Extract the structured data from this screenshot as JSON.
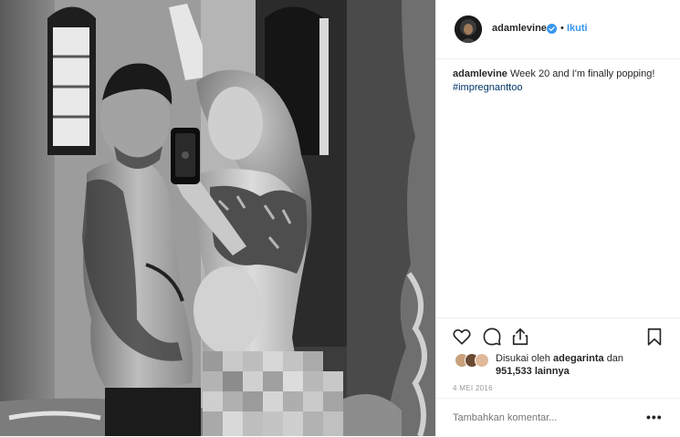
{
  "post": {
    "username": "adamlevine",
    "follow_label": "Ikuti",
    "separator": "•",
    "caption": {
      "username": "adamlevine",
      "text": "Week 20 and I'm finally popping!",
      "hashtag": "#impregnanttoo"
    },
    "likes": {
      "prefix": "Disukai oleh",
      "liker": "adegarinta",
      "middle": "dan",
      "count": "951,533",
      "suffix": "lainnya"
    },
    "date": "4 MEI 2016",
    "comment_placeholder": "Tambahkan komentar...",
    "more_label": "•••"
  },
  "icons": {
    "verified": "verified-badge-icon",
    "like": "heart-icon",
    "comment": "comment-bubble-icon",
    "share": "share-icon",
    "save": "bookmark-icon",
    "more": "more-options-icon"
  },
  "colors": {
    "link_blue": "#3897f0",
    "hashtag": "#003569",
    "text": "#262626",
    "muted": "#999999",
    "divider": "#efefef"
  }
}
